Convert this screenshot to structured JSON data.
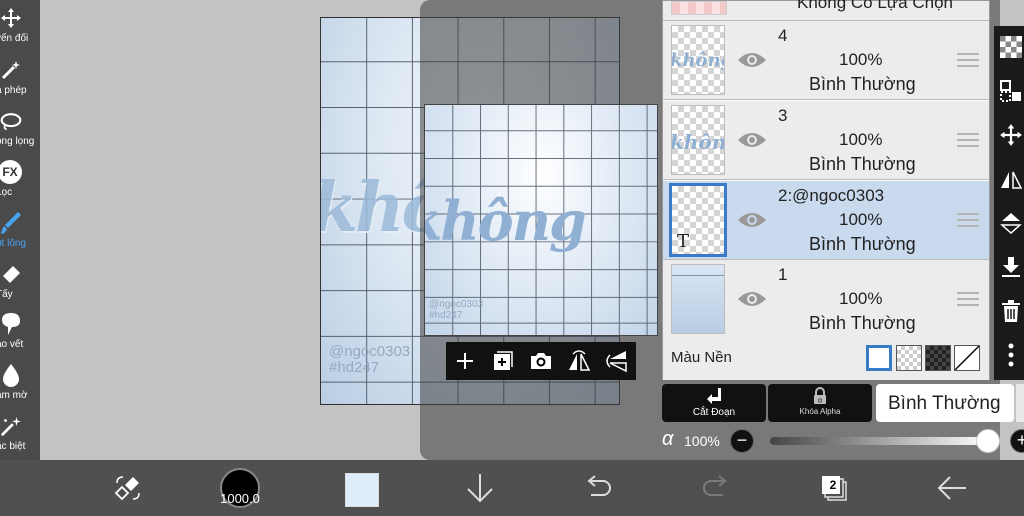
{
  "left_toolbar": {
    "tools": [
      {
        "label": "yển đổi",
        "icon": "move-icon"
      },
      {
        "label": "a phép",
        "icon": "magic-wand-icon"
      },
      {
        "label": "ong lọng",
        "icon": "lasso-icon"
      },
      {
        "label": "Lọc",
        "icon": "fx-filter-icon",
        "badge": "FX"
      },
      {
        "label": "út lông",
        "icon": "brush-icon",
        "active": true
      },
      {
        "label": "Tẩy",
        "icon": "eraser-icon"
      },
      {
        "label": "ạo vết",
        "icon": "smudge-icon"
      },
      {
        "label": "àm mờ",
        "icon": "blur-drop-icon"
      },
      {
        "label": "ặc biệt",
        "icon": "special-brush-icon"
      },
      {
        "label": "Xô",
        "icon": "fill-bucket-icon"
      }
    ]
  },
  "canvas": {
    "watermark_line1": "@ngoc0303",
    "watermark_line2": "#hd247",
    "script_text": "không"
  },
  "preview": {
    "watermark_line1": "@ngoc0303",
    "watermark_line2": "#hd247",
    "script_text": "không"
  },
  "layers_panel": {
    "top_partial_label": "Không Có Lựa Chọn",
    "layers": [
      {
        "name": "4",
        "opacity": "100%",
        "blend": "Bình Thường",
        "selected": false,
        "thumb": "script"
      },
      {
        "name": "3",
        "opacity": "100%",
        "blend": "Bình Thường",
        "selected": false,
        "thumb": "script"
      },
      {
        "name": "2:@ngoc0303",
        "opacity": "100%",
        "blend": "Bình Thường",
        "selected": true,
        "thumb": "text",
        "thumb_letter": "T"
      },
      {
        "name": "1",
        "opacity": "100%",
        "blend": "Bình Thường",
        "selected": false,
        "thumb": "background"
      }
    ],
    "background_color_label": "Màu Nền"
  },
  "layer_controls": {
    "clipping_label": "Cắt Đoạn",
    "alpha_lock_label": "Khóa Alpha",
    "blend_mode": "Bình Thường",
    "alpha_symbol": "α",
    "opacity_value": "100%",
    "opacity_fraction": 1.0,
    "minus_label": "−",
    "plus_label": "+"
  },
  "bottom_bar": {
    "brush_size": "1000.0",
    "layer_count": "2",
    "current_color": "#deecfb"
  },
  "colors": {
    "accent": "#3a7bc8",
    "toolbar_bg": "#4a4a4a",
    "active_tool": "#4aa3f0"
  }
}
